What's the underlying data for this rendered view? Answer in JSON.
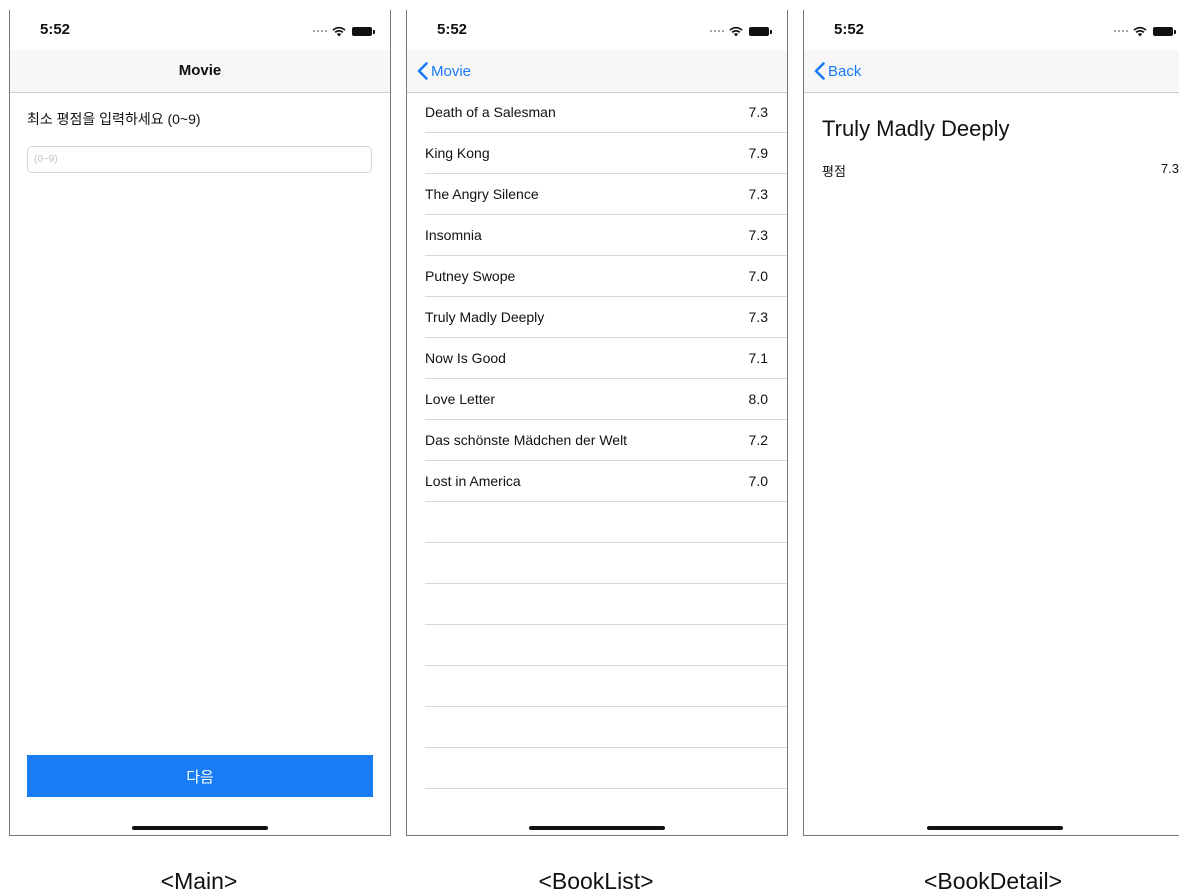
{
  "status_time": "5:52",
  "main": {
    "nav_title": "Movie",
    "prompt": "최소 평점을 입력하세요 (0~9)",
    "input_placeholder": "(0~9)",
    "input_value": "",
    "next_button": "다음",
    "caption": "<Main>"
  },
  "list": {
    "back_label": "Movie",
    "items": [
      {
        "title": "Death of a Salesman",
        "rating": "7.3"
      },
      {
        "title": "King Kong",
        "rating": "7.9"
      },
      {
        "title": "The Angry Silence",
        "rating": "7.3"
      },
      {
        "title": "Insomnia",
        "rating": "7.3"
      },
      {
        "title": "Putney Swope",
        "rating": "7.0"
      },
      {
        "title": "Truly Madly Deeply",
        "rating": "7.3"
      },
      {
        "title": "Now Is Good",
        "rating": "7.1"
      },
      {
        "title": "Love Letter",
        "rating": "8.0"
      },
      {
        "title": "Das schönste Mädchen der Welt",
        "rating": "7.2"
      },
      {
        "title": "Lost in America",
        "rating": "7.0"
      }
    ],
    "caption": "<BookList>"
  },
  "detail": {
    "back_label": "Back",
    "title": "Truly Madly Deeply",
    "rating_label": "평점",
    "rating_value": "7.3",
    "caption": "<BookDetail>"
  },
  "colors": {
    "accent": "#1a7cf5"
  },
  "icons": [
    "signal-icon",
    "wifi-icon",
    "battery-icon",
    "chevron-left-icon"
  ]
}
